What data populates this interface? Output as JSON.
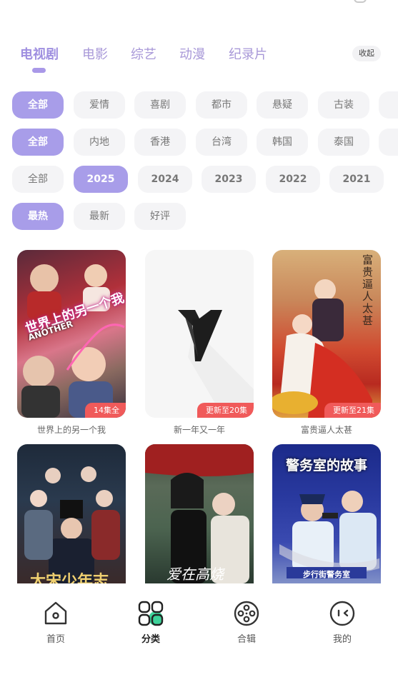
{
  "tabs": [
    {
      "label": "电视剧",
      "active": true
    },
    {
      "label": "电影"
    },
    {
      "label": "综艺"
    },
    {
      "label": "动漫"
    },
    {
      "label": "纪录片"
    }
  ],
  "collapse_label": "收起",
  "filters": {
    "genre": [
      "全部",
      "爱情",
      "喜剧",
      "都市",
      "悬疑",
      "古装"
    ],
    "region": [
      "全部",
      "内地",
      "香港",
      "台湾",
      "韩国",
      "泰国"
    ],
    "year": [
      "全部",
      "2025",
      "2024",
      "2023",
      "2022",
      "2021"
    ],
    "sort": [
      "最热",
      "最新",
      "好评"
    ]
  },
  "cards": [
    {
      "title": "世界上的另一个我",
      "badge": "14集全",
      "poster_text": "世界上的另一个我",
      "poster_sub": "ANOTHER"
    },
    {
      "title": "新一年又一年",
      "badge": "更新至20集"
    },
    {
      "title": "富贵逼人太甚",
      "badge": "更新至21集",
      "poster_text": "富贵逼人太甚"
    },
    {
      "title": "",
      "poster_text": "大宋少年志"
    },
    {
      "title": "",
      "poster_text": "爱在高烧"
    },
    {
      "title": "",
      "poster_text": "警务室的故事",
      "poster_sub": "步行街警务室"
    }
  ],
  "nav": [
    {
      "label": "首页",
      "icon": "home-icon"
    },
    {
      "label": "分类",
      "icon": "category-icon",
      "active": true
    },
    {
      "label": "合辑",
      "icon": "film-reel-icon"
    },
    {
      "label": "我的",
      "icon": "profile-face-icon"
    }
  ],
  "colors": {
    "accent": "#a89de9",
    "badge": "#f05a5a",
    "nav_green": "#3ed39a"
  }
}
